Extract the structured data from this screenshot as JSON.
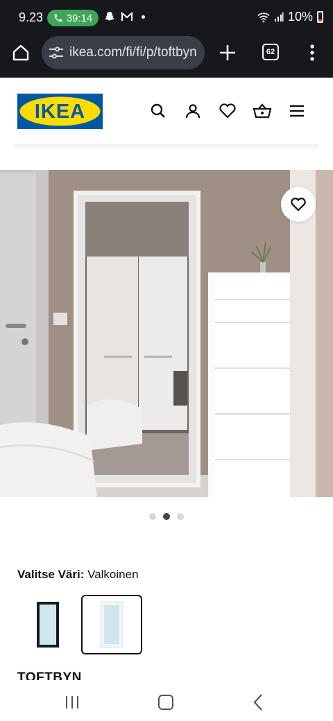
{
  "status_bar": {
    "time": "9.23",
    "call_duration": "39:14",
    "battery_percent": "10%",
    "battery_color": "#e8473b",
    "call_color": "#3fa557"
  },
  "browser": {
    "url": "ikea.com/fi/fi/p/toftbyn",
    "tab_count": "62",
    "bar_color": "#16181c"
  },
  "site": {
    "logo_text": "IKEA",
    "brand_blue": "#0058a3",
    "brand_yellow": "#ffdb00",
    "header_icons": [
      "search-icon",
      "user-icon",
      "heart-icon",
      "basket-icon",
      "hamburger-menu-icon"
    ]
  },
  "product": {
    "image_count": 3,
    "active_image_index": 1,
    "color_prefix": "Valitse Väri:",
    "color_value": "Valkoinen",
    "color_options": [
      "black",
      "white"
    ],
    "selected_color_index": 1,
    "name": "TOFTBYN"
  }
}
